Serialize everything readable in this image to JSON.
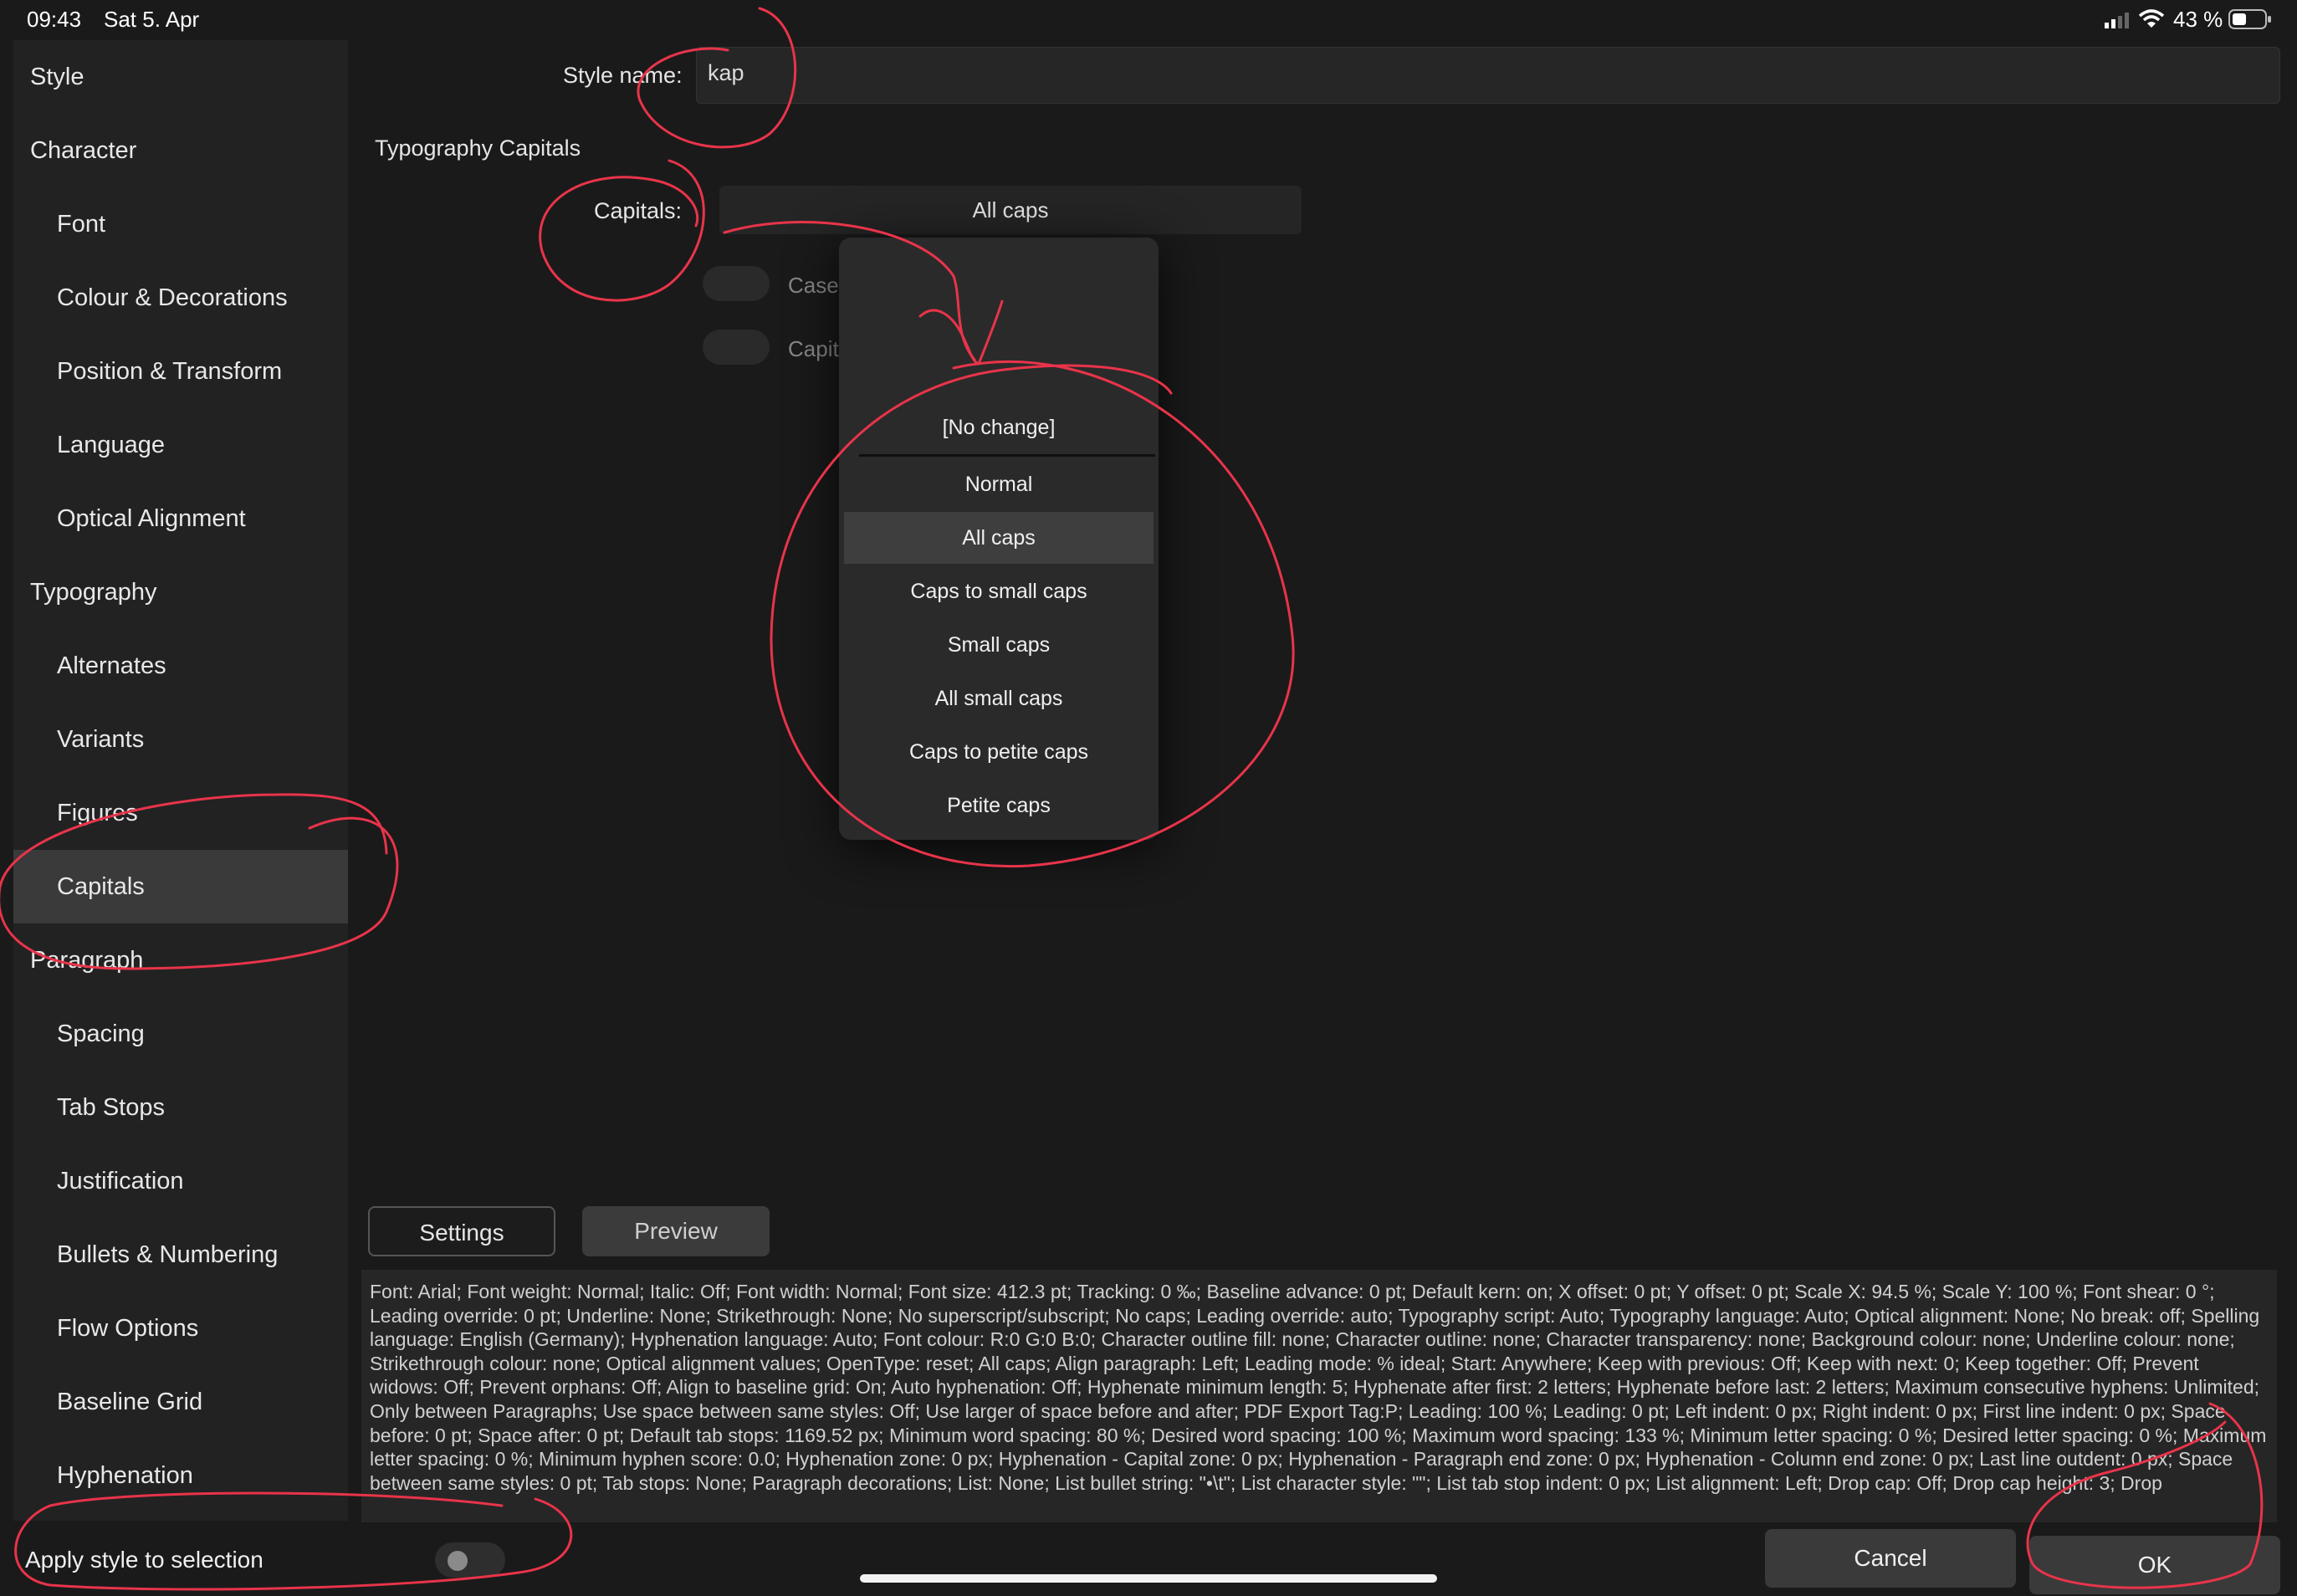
{
  "status_bar": {
    "time": "09:43",
    "date": "Sat 5. Apr",
    "battery": "43 %",
    "icons": [
      "signal-icon",
      "wifi-icon",
      "battery-icon"
    ]
  },
  "sidebar": {
    "items": [
      {
        "label": "Style",
        "level": "top",
        "selected": false
      },
      {
        "label": "Character",
        "level": "top",
        "selected": false
      },
      {
        "label": "Font",
        "level": "sub",
        "selected": false
      },
      {
        "label": "Colour & Decorations",
        "level": "sub",
        "selected": false
      },
      {
        "label": "Position & Transform",
        "level": "sub",
        "selected": false
      },
      {
        "label": "Language",
        "level": "sub",
        "selected": false
      },
      {
        "label": "Optical Alignment",
        "level": "sub",
        "selected": false
      },
      {
        "label": "Typography",
        "level": "top",
        "selected": false
      },
      {
        "label": "Alternates",
        "level": "sub",
        "selected": false
      },
      {
        "label": "Variants",
        "level": "sub",
        "selected": false
      },
      {
        "label": "Figures",
        "level": "sub",
        "selected": false
      },
      {
        "label": "Capitals",
        "level": "sub",
        "selected": true
      },
      {
        "label": "Paragraph",
        "level": "top",
        "selected": false
      },
      {
        "label": "Spacing",
        "level": "sub",
        "selected": false
      },
      {
        "label": "Tab Stops",
        "level": "sub",
        "selected": false
      },
      {
        "label": "Justification",
        "level": "sub",
        "selected": false
      },
      {
        "label": "Bullets & Numbering",
        "level": "sub",
        "selected": false
      },
      {
        "label": "Flow Options",
        "level": "sub",
        "selected": false
      },
      {
        "label": "Baseline Grid",
        "level": "sub",
        "selected": false
      },
      {
        "label": "Hyphenation",
        "level": "sub",
        "selected": false
      }
    ]
  },
  "form": {
    "style_name_label": "Style name:",
    "style_name_value": "kap",
    "section_title": "Typography Capitals",
    "capitals_label": "Capitals:",
    "capitals_value": "All caps",
    "hidden_row_1": "Case",
    "hidden_row_2": "Capit"
  },
  "dropdown": {
    "no_change": "[No change]",
    "options": [
      "Normal",
      "All caps",
      "Caps to small caps",
      "Small caps",
      "All small caps",
      "Caps to petite caps",
      "Petite caps"
    ],
    "selected": "All caps"
  },
  "tabs": {
    "settings": "Settings",
    "preview": "Preview"
  },
  "description": "Font: Arial; Font weight: Normal; Italic: Off; Font width: Normal; Font size: 412.3 pt; Tracking: 0 ‰; Baseline advance: 0 pt; Default kern: on; X offset: 0 pt; Y offset: 0 pt; Scale X: 94.5 %; Scale Y: 100 %; Font shear: 0 °; Leading override: 0 pt; Underline: None; Strikethrough: None; No superscript/subscript; No caps; Leading override: auto; Typography script: Auto; Typography language: Auto; Optical alignment: None; No break: off; Spelling language: English (Germany); Hyphenation language: Auto; Font colour: R:0 G:0 B:0; Character outline fill: none; Character outline: none; Character transparency: none; Background colour: none; Underline colour: none; Strikethrough colour: none; Optical alignment values; OpenType: reset; All caps; Align paragraph: Left; Leading mode: % ideal; Start: Anywhere; Keep with previous: Off; Keep with next: 0; Keep together: Off; Prevent widows: Off; Prevent orphans: Off; Align to baseline grid: On; Auto hyphenation: Off; Hyphenate minimum length: 5; Hyphenate after first: 2 letters; Hyphenate before last: 2 letters; Maximum consecutive hyphens: Unlimited; Only between Paragraphs; Use space between same styles: Off; Use larger of space before and after; PDF Export Tag:P; Leading: 100 %; Leading: 0 pt; Left indent: 0 px; Right indent: 0 px; First line indent: 0 px; Space before: 0 pt; Space after: 0 pt; Default tab stops: 1169.52 px; Minimum word spacing: 80 %; Desired word spacing: 100 %; Maximum word spacing: 133 %; Minimum letter spacing: 0 %; Desired letter spacing: 0 %; Maximum letter spacing: 0 %; Minimum hyphen score: 0.0; Hyphenation zone: 0 px; Hyphenation - Capital zone: 0 px; Hyphenation - Paragraph end zone: 0 px; Hyphenation - Column end zone: 0 px; Last line outdent: 0 px; Space between same styles: 0 pt; Tab stops: None; Paragraph decorations; List: None; List bullet string: \"•\\t\"; List character style: \"\"; List tab stop indent: 0 px; List alignment: Left; Drop cap: Off; Drop cap height: 3; Drop",
  "bottom": {
    "apply_label": "Apply style to selection",
    "apply_toggle_on": false,
    "cancel": "Cancel",
    "ok": "OK"
  },
  "colors": {
    "background": "#1a1a1a",
    "sidebar": "#222222",
    "selected": "#3a3a3a",
    "annotation": "#e8344a"
  }
}
